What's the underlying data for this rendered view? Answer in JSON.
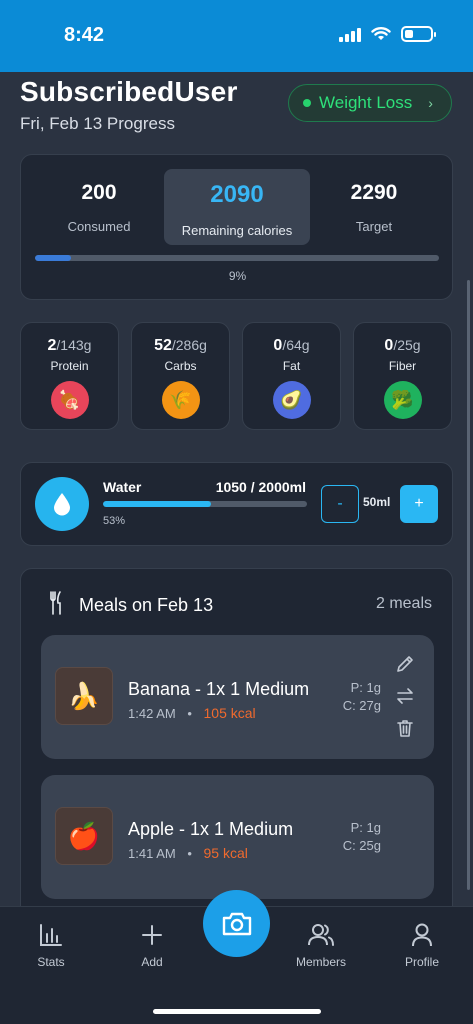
{
  "status": {
    "time": "8:42"
  },
  "header": {
    "user_name": "SubscribedUser",
    "progress_date": "Fri, Feb 13 Progress",
    "goal_label": "Weight Loss"
  },
  "calories": {
    "consumed": {
      "value": "200",
      "label": "Consumed"
    },
    "remaining": {
      "value": "2090",
      "label": "Remaining calories"
    },
    "target": {
      "value": "2290",
      "label": "Target"
    },
    "percent_text": "9%",
    "percent": 9
  },
  "macros": [
    {
      "value": "2",
      "target": "/143g",
      "label": "Protein",
      "icon": "meat-icon",
      "color": "#e8455a"
    },
    {
      "value": "52",
      "target": "/286g",
      "label": "Carbs",
      "icon": "wheat-icon",
      "color": "#f39414"
    },
    {
      "value": "0",
      "target": "/64g",
      "label": "Fat",
      "icon": "avocado-icon",
      "color": "#4f6ce0"
    },
    {
      "value": "0",
      "target": "/25g",
      "label": "Fiber",
      "icon": "broccoli-icon",
      "color": "#1fb25e"
    }
  ],
  "water": {
    "title": "Water",
    "amount": "1050 / 2000ml",
    "percent_text": "53%",
    "percent": 53,
    "minus_label": "-",
    "step": "50ml",
    "plus_label": "+"
  },
  "meals": {
    "title": "Meals on Feb 13",
    "count": "2 meals",
    "items": [
      {
        "name": "Banana - 1x 1 Medium",
        "time": "1:42 AM",
        "kcal": "105 kcal",
        "protein": "P: 1g",
        "carbs": "C: 27g",
        "emoji": "🍌"
      },
      {
        "name": "Apple - 1x 1 Medium",
        "time": "1:41 AM",
        "kcal": "95 kcal",
        "protein": "P: 1g",
        "carbs": "C: 25g",
        "emoji": "🍎"
      }
    ]
  },
  "tabs": {
    "stats": "Stats",
    "add": "Add",
    "members": "Members",
    "profile": "Profile"
  },
  "colors": {
    "accent": "#1c9fe8",
    "goal_green": "#2ee07a",
    "kcal_orange": "#ef6a2e"
  }
}
